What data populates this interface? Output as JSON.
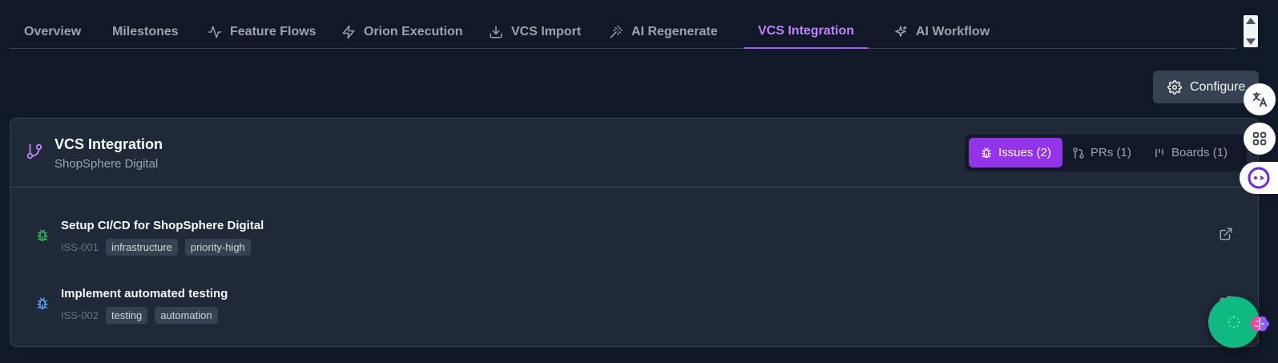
{
  "tabs": [
    {
      "label": "Overview",
      "icon": "none"
    },
    {
      "label": "Milestones",
      "icon": "none"
    },
    {
      "label": "Feature Flows",
      "icon": "activity-icon"
    },
    {
      "label": "Orion Execution",
      "icon": "zap-icon"
    },
    {
      "label": "VCS Import",
      "icon": "download-icon"
    },
    {
      "label": "AI Regenerate",
      "icon": "magic-wand-icon"
    },
    {
      "label": "VCS Integration",
      "icon": "none",
      "active": true
    },
    {
      "label": "AI Workflow",
      "icon": "sparkles-icon"
    }
  ],
  "configure_label": "Configure",
  "panel": {
    "title": "VCS Integration",
    "subtitle": "ShopSphere Digital",
    "segments": [
      {
        "label": "Issues (2)",
        "icon": "bug-icon",
        "active": true
      },
      {
        "label": "PRs (1)",
        "icon": "git-pull-request-icon"
      },
      {
        "label": "Boards (1)",
        "icon": "kanban-icon"
      }
    ],
    "issues": [
      {
        "title": "Setup CI/CD for ShopSphere Digital",
        "id": "ISS-001",
        "tags": [
          "infrastructure",
          "priority-high"
        ],
        "icon_color": "#22c55e"
      },
      {
        "title": "Implement automated testing",
        "id": "ISS-002",
        "tags": [
          "testing",
          "automation"
        ],
        "icon_color": "#60a5fa"
      }
    ]
  },
  "colors": {
    "accent": "#a855f7",
    "active_segment": "#9333ea",
    "background": "#111827",
    "panel": "#1f2937",
    "fab": "#10b981"
  }
}
